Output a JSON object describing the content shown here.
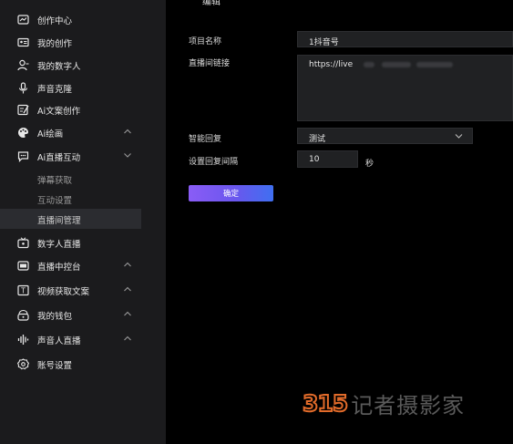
{
  "sidebar": {
    "items": [
      {
        "label": "创作中心",
        "icon": "chart-card-icon",
        "chevron": false
      },
      {
        "label": "我的创作",
        "icon": "id-card-icon",
        "chevron": false
      },
      {
        "label": "我的数字人",
        "icon": "user-icon",
        "chevron": false
      },
      {
        "label": "声音克隆",
        "icon": "microphone-icon",
        "chevron": false
      },
      {
        "label": "Ai文案创作",
        "icon": "edit-doc-icon",
        "chevron": false
      },
      {
        "label": "Ai绘画",
        "icon": "palette-icon",
        "chevron": true
      },
      {
        "label": "Ai直播互动",
        "icon": "chat-bubble-icon",
        "chevron": true
      },
      {
        "label": "数字人直播",
        "icon": "tv-icon",
        "chevron": false
      },
      {
        "label": "直播中控台",
        "icon": "console-icon",
        "chevron": true
      },
      {
        "label": "视频获取文案",
        "icon": "text-box-icon",
        "chevron": true
      },
      {
        "label": "我的钱包",
        "icon": "wallet-icon",
        "chevron": true
      },
      {
        "label": "声音人直播",
        "icon": "soundwave-icon",
        "chevron": true
      },
      {
        "label": "账号设置",
        "icon": "gear-icon",
        "chevron": false
      }
    ],
    "sub_items": [
      {
        "label": "弹幕获取",
        "active": false
      },
      {
        "label": "互动设置",
        "active": false
      },
      {
        "label": "直播间管理",
        "active": true
      }
    ]
  },
  "form": {
    "header_partial": "编辑",
    "project_name_label": "项目名称",
    "project_name_value": "1抖音号",
    "live_link_label": "直播间链接",
    "live_link_value": "https://live",
    "smart_reply_label": "智能回复",
    "smart_reply_value": "测试",
    "interval_label": "设置回复间隔",
    "interval_value": "10",
    "interval_unit": "秒",
    "confirm_label": "确定"
  },
  "watermark": {
    "logo": "315",
    "text": "记者摄影家"
  },
  "colors": {
    "sidebar_bg": "#1b1b1d",
    "content_bg": "#000000",
    "input_bg": "#202123",
    "active_bg": "#2b2c30",
    "button_gradient_start": "#8a5cf6",
    "button_gradient_end": "#3f6ff0",
    "watermark_logo": "#e26b2a"
  }
}
